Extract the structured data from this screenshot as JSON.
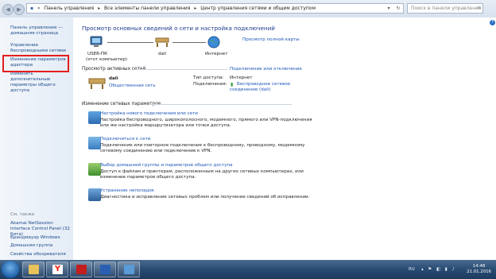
{
  "window": {
    "breadcrumb": [
      "Панель управления",
      "Все элементы панели управления",
      "Центр управления сетями и общим доступом"
    ],
    "search_placeholder": "Поиск в панели управления"
  },
  "sidebar": {
    "items": [
      "Панель управления — домашняя страница",
      "Управление беспроводными сетями",
      "Изменение параметров адаптера",
      "Изменить дополнительные параметры общего доступа"
    ],
    "see_also_title": "См. также",
    "see_also": [
      "Akamai NetSession Interface Control Panel (32 бита)",
      "Брандмауэр Windows",
      "Домашняя группа",
      "Свойства обозревателя"
    ]
  },
  "main": {
    "title": "Просмотр основных сведений о сети и настройка подключений",
    "full_map_link": "Просмотр полной карты",
    "nodes": {
      "pc_name": "USER-ПК",
      "pc_sub": "(этот компьютер)",
      "net_name": "dali",
      "internet": "Интернет"
    },
    "active_networks_title": "Просмотр активных сетей",
    "connect_link": "Подключение или отключение",
    "network": {
      "name": "dali",
      "type_link": "Общественная сеть",
      "access_label": "Тип доступа:",
      "access_value": "Интернет",
      "connections_label": "Подключения:",
      "connection_link_1": "Беспроводное сетевое",
      "connection_link_2": "соединение (dali)"
    },
    "change_settings_title": "Изменение сетевых параметров",
    "tasks": [
      {
        "link": "Настройка нового подключения или сети",
        "desc1": "Настройка беспроводного, широкополосного, модемного, прямого или VPN-подключения",
        "desc2": "или же настройка маршрутизатора или точки доступа."
      },
      {
        "link": "Подключиться к сети",
        "desc1": "Подключение или повторное подключение к беспроводному, проводному, модемному",
        "desc2": "сетевому соединению или подключение к VPN."
      },
      {
        "link": "Выбор домашней группы и параметров общего доступа",
        "desc1": "Доступ к файлам и принтерам, расположенным на других сетевых компьютерах, или",
        "desc2": "изменение параметров общего доступа."
      },
      {
        "link": "Устранение неполадок",
        "desc1": "Диагностика и исправление сетевых проблем или получение сведений об исправлении.",
        "desc2": ""
      }
    ]
  },
  "taskbar": {
    "lang": "RU",
    "time": "14:48",
    "date": "21.01.2016"
  },
  "colors": {
    "link": "#1c56b8",
    "highlight": "#e31e1e"
  }
}
